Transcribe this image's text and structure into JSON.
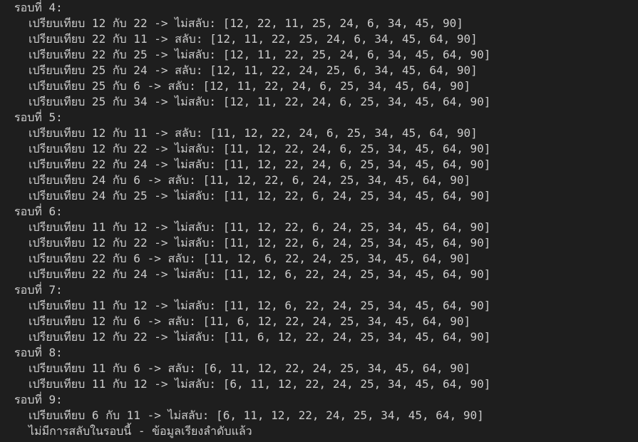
{
  "terminal": {
    "lines": [
      {
        "type": "header",
        "text": "รอบที่ 4:"
      },
      {
        "type": "step",
        "text": "เปรียบเทียบ 12 กับ 22 -> ไม่สลับ: [12, 22, 11, 25, 24, 6, 34, 45, 90]"
      },
      {
        "type": "step",
        "text": "เปรียบเทียบ 22 กับ 11 -> สลับ: [12, 11, 22, 25, 24, 6, 34, 45, 64, 90]"
      },
      {
        "type": "step",
        "text": "เปรียบเทียบ 22 กับ 25 -> ไม่สลับ: [12, 11, 22, 25, 24, 6, 34, 45, 64, 90]"
      },
      {
        "type": "step",
        "text": "เปรียบเทียบ 25 กับ 24 -> สลับ: [12, 11, 22, 24, 25, 6, 34, 45, 64, 90]"
      },
      {
        "type": "step",
        "text": "เปรียบเทียบ 25 กับ 6 -> สลับ: [12, 11, 22, 24, 6, 25, 34, 45, 64, 90]"
      },
      {
        "type": "step",
        "text": "เปรียบเทียบ 25 กับ 34 -> ไม่สลับ: [12, 11, 22, 24, 6, 25, 34, 45, 64, 90]"
      },
      {
        "type": "header",
        "text": "รอบที่ 5:"
      },
      {
        "type": "step",
        "text": "เปรียบเทียบ 12 กับ 11 -> สลับ: [11, 12, 22, 24, 6, 25, 34, 45, 64, 90]"
      },
      {
        "type": "step",
        "text": "เปรียบเทียบ 12 กับ 22 -> ไม่สลับ: [11, 12, 22, 24, 6, 25, 34, 45, 64, 90]"
      },
      {
        "type": "step",
        "text": "เปรียบเทียบ 22 กับ 24 -> ไม่สลับ: [11, 12, 22, 24, 6, 25, 34, 45, 64, 90]"
      },
      {
        "type": "step",
        "text": "เปรียบเทียบ 24 กับ 6 -> สลับ: [11, 12, 22, 6, 24, 25, 34, 45, 64, 90]"
      },
      {
        "type": "step",
        "text": "เปรียบเทียบ 24 กับ 25 -> ไม่สลับ: [11, 12, 22, 6, 24, 25, 34, 45, 64, 90]"
      },
      {
        "type": "header",
        "text": "รอบที่ 6:"
      },
      {
        "type": "step",
        "text": "เปรียบเทียบ 11 กับ 12 -> ไม่สลับ: [11, 12, 22, 6, 24, 25, 34, 45, 64, 90]"
      },
      {
        "type": "step",
        "text": "เปรียบเทียบ 12 กับ 22 -> ไม่สลับ: [11, 12, 22, 6, 24, 25, 34, 45, 64, 90]"
      },
      {
        "type": "step",
        "text": "เปรียบเทียบ 22 กับ 6 -> สลับ: [11, 12, 6, 22, 24, 25, 34, 45, 64, 90]"
      },
      {
        "type": "step",
        "text": "เปรียบเทียบ 22 กับ 24 -> ไม่สลับ: [11, 12, 6, 22, 24, 25, 34, 45, 64, 90]"
      },
      {
        "type": "header",
        "text": "รอบที่ 7:"
      },
      {
        "type": "step",
        "text": "เปรียบเทียบ 11 กับ 12 -> ไม่สลับ: [11, 12, 6, 22, 24, 25, 34, 45, 64, 90]"
      },
      {
        "type": "step",
        "text": "เปรียบเทียบ 12 กับ 6 -> สลับ: [11, 6, 12, 22, 24, 25, 34, 45, 64, 90]"
      },
      {
        "type": "step",
        "text": "เปรียบเทียบ 12 กับ 22 -> ไม่สลับ: [11, 6, 12, 22, 24, 25, 34, 45, 64, 90]"
      },
      {
        "type": "header",
        "text": "รอบที่ 8:"
      },
      {
        "type": "step",
        "text": "เปรียบเทียบ 11 กับ 6 -> สลับ: [6, 11, 12, 22, 24, 25, 34, 45, 64, 90]"
      },
      {
        "type": "step",
        "text": "เปรียบเทียบ 11 กับ 12 -> ไม่สลับ: [6, 11, 12, 22, 24, 25, 34, 45, 64, 90]"
      },
      {
        "type": "header",
        "text": "รอบที่ 9:"
      },
      {
        "type": "step",
        "text": "เปรียบเทียบ 6 กับ 11 -> ไม่สลับ: [6, 11, 12, 22, 24, 25, 34, 45, 64, 90]"
      },
      {
        "type": "done",
        "text": "ไม่มีการสลับในรอบนี้ - ข้อมูลเรียงลำดับแล้ว"
      }
    ]
  },
  "colors": {
    "background": "#1e1e1e",
    "text": "#cccccc"
  }
}
